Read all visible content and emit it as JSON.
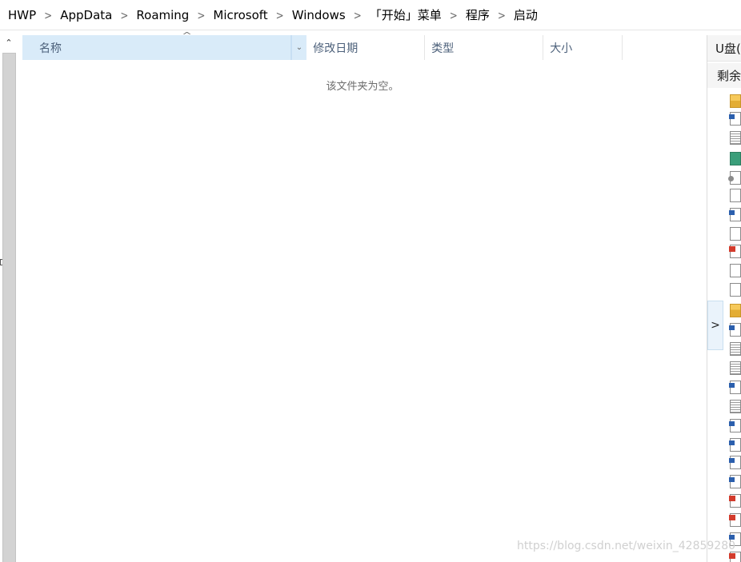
{
  "breadcrumb": [
    "HWP",
    "AppData",
    "Roaming",
    "Microsoft",
    "Windows",
    "「开始」菜单",
    "程序",
    "启动"
  ],
  "columns": {
    "name": "名称",
    "date_modified": "修改日期",
    "type": "类型",
    "size": "大小"
  },
  "empty_message": "该文件夹为空。",
  "details_pane": {
    "title": "U盘(",
    "subtitle": "剩余"
  },
  "file_icon_kinds": [
    "folder",
    "word",
    "text",
    "img",
    "gear",
    "blank",
    "word",
    "blank",
    "pdf",
    "blank",
    "blank",
    "folder",
    "word",
    "text",
    "text",
    "word",
    "text",
    "word",
    "word",
    "word",
    "word",
    "pdf",
    "pdf",
    "word",
    "pdf"
  ],
  "watermark": "https://blog.csdn.net/weixin_42859280",
  "icons": {
    "separator": "chevron-right-icon",
    "sort": "sort-ascending-icon",
    "dropdown": "chevron-down-icon",
    "expand": "chevron-right-icon"
  },
  "colors": {
    "header_selected_bg": "#d9ebf9",
    "header_text": "#4c607a",
    "scrollbar": "#d3d3d3"
  }
}
